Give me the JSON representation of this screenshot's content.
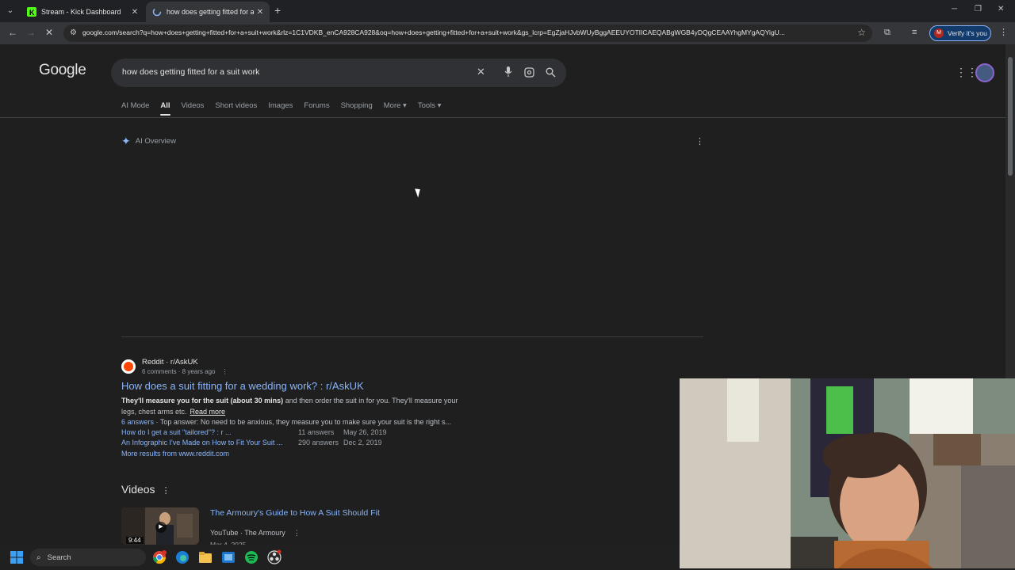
{
  "browser": {
    "tabs": [
      {
        "title": "Stream - Kick Dashboard"
      },
      {
        "title": "how does getting fitted for a suit work - Google Search"
      }
    ],
    "url": "google.com/search?q=how+does+getting+fitted+for+a+suit+work&rlz=1C1VDKB_enCA928CA928&oq=how+does+getting+fitted+for+a+suit+work&gs_lcrp=EgZjaHJvbWUyBggAEEUYOTIICAEQABgWGB4yDQgCEAAYhgMYgAQYigU...",
    "verify_label": "Verify it's you"
  },
  "google": {
    "logo": "Google",
    "query": "how does getting fitted for a suit work",
    "tabs": [
      "AI Mode",
      "All",
      "Videos",
      "Short videos",
      "Images",
      "Forums",
      "Shopping",
      "More",
      "Tools"
    ],
    "ai_overview_label": "AI Overview"
  },
  "result": {
    "source_name": "Reddit · r/AskUK",
    "source_meta": "6 comments · 8 years ago",
    "title": "How does a suit fitting for a wedding work? : r/AskUK",
    "snippet_bold": "They'll measure you for the suit (about 30 mins)",
    "snippet_rest": " and then order the suit in for you. They'll measure your legs, chest arms etc.",
    "read_more": "Read more",
    "answers_count": "6 answers",
    "answers_text": " · Top answer: No need to be anxious, they measure you to make sure your suit is the right s...",
    "sublinks": [
      {
        "label": "How do I get a suit \"tailored\"? : r ...",
        "count": "11 answers",
        "date": "May 26, 2019"
      },
      {
        "label": "An Infographic I've Made on How to Fit Your Suit ...",
        "count": "290 answers",
        "date": "Dec 2, 2019"
      }
    ],
    "more_results": "More results from www.reddit.com"
  },
  "videos": {
    "heading": "Videos",
    "items": [
      {
        "title": "The Armoury's Guide to How A Suit Should Fit",
        "source": "YouTube · The Armoury",
        "duration": "9:44",
        "date": "Mar 4, 2025"
      }
    ]
  },
  "taskbar": {
    "search_placeholder": "Search"
  },
  "colors": {
    "link": "#8ab4f8",
    "background": "#1f1f1f",
    "kick_green": "#53fc18"
  }
}
